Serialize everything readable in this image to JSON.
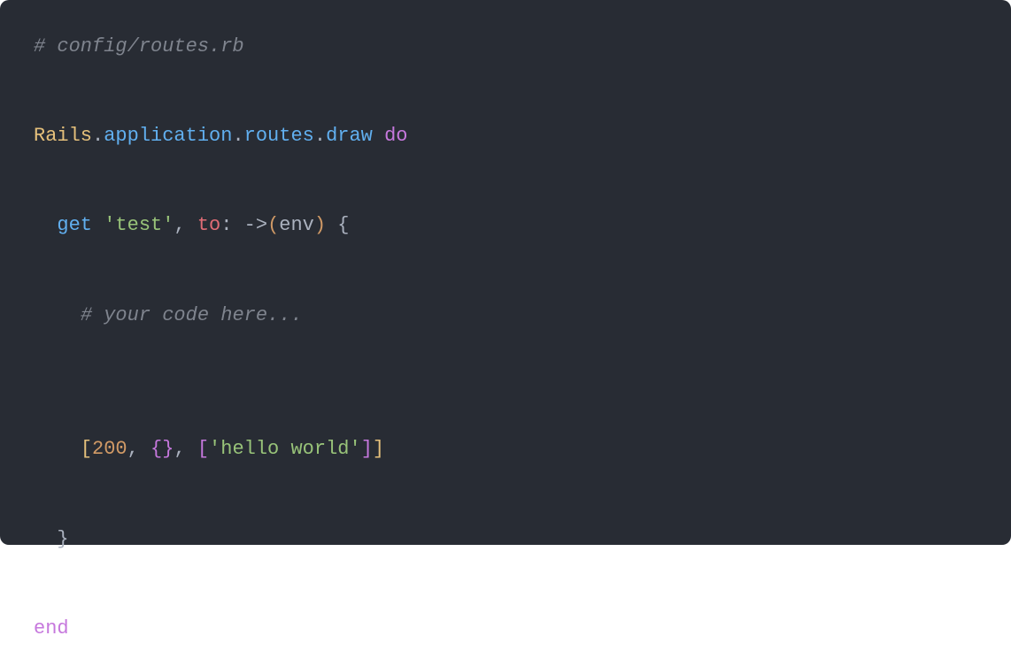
{
  "code": {
    "comment_file": "# config/routes.rb",
    "rails": "Rails",
    "dot1": ".",
    "application": "application",
    "dot2": ".",
    "routes": "routes",
    "dot3": ".",
    "draw": "draw",
    "sp1": " ",
    "do": "do",
    "indent1": "  ",
    "get": "get",
    "sp2": " ",
    "str_test": "'test'",
    "comma1": ", ",
    "to": "to",
    "colon": ":",
    "sp3": " ",
    "arrow": "->",
    "lparen": "(",
    "env": "env",
    "rparen": ")",
    "sp4": " ",
    "lbrace": "{",
    "indent2": "    ",
    "comment_body": "# your code here...",
    "indent3": "    ",
    "lbrack1": "[",
    "num200": "200",
    "comma2": ", ",
    "lbrace2": "{",
    "rbrace2": "}",
    "comma3": ", ",
    "lbrack2": "[",
    "str_hello": "'hello world'",
    "rbrack2": "]",
    "rbrack1": "]",
    "indent4": "  ",
    "rbrace": "}",
    "end": "end"
  }
}
